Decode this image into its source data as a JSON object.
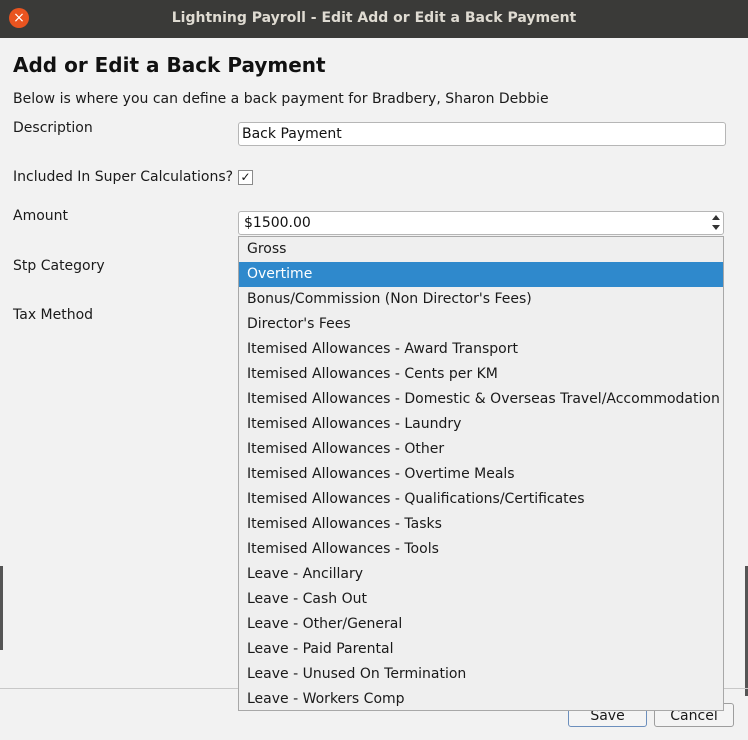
{
  "window": {
    "title": "Lightning Payroll - Edit Add or Edit a Back Payment",
    "close_glyph": "×"
  },
  "dialog": {
    "heading": "Add or Edit a Back Payment",
    "subtitle": "Below is where you can define a back payment for Bradbery, Sharon Debbie"
  },
  "form": {
    "description_label": "Description",
    "description_value": "Back Payment",
    "super_label": "Included In Super Calculations?",
    "super_checked_glyph": "✓",
    "amount_label": "Amount",
    "amount_value": "$1500.00",
    "stp_label": "Stp Category",
    "tax_label": "Tax Method"
  },
  "stp_dropdown": {
    "selected": "Overtime",
    "options": [
      "Gross",
      "Overtime",
      "Bonus/Commission (Non Director's Fees)",
      "Director's Fees",
      "Itemised Allowances - Award Transport",
      "Itemised Allowances - Cents per KM",
      "Itemised Allowances - Domestic & Overseas Travel/Accommodation",
      "Itemised Allowances - Laundry",
      "Itemised Allowances - Other",
      "Itemised Allowances - Overtime Meals",
      "Itemised Allowances - Qualifications/Certificates",
      "Itemised Allowances - Tasks",
      "Itemised Allowances - Tools",
      "Leave - Ancillary",
      "Leave - Cash Out",
      "Leave - Other/General",
      "Leave - Paid Parental",
      "Leave - Unused On Termination",
      "Leave - Workers Comp"
    ]
  },
  "buttons": {
    "save": "Save",
    "cancel": "Cancel"
  },
  "colors": {
    "accent_selected": "#2f89cc",
    "close_button": "#e95420"
  }
}
